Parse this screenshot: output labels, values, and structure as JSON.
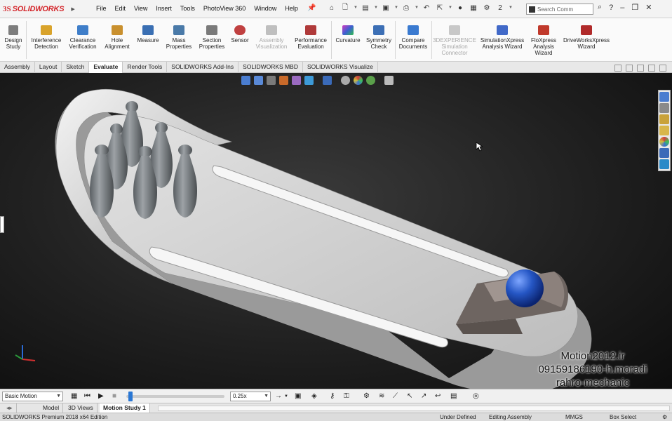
{
  "app": {
    "logo_ds": "3S",
    "logo_name": "SOLIDWORKS"
  },
  "menu": [
    "File",
    "Edit",
    "View",
    "Insert",
    "Tools",
    "PhotoView 360",
    "Window",
    "Help"
  ],
  "quick_access": {
    "icons": [
      "home-icon",
      "new-document-icon",
      "open-icon",
      "save-icon",
      "print-icon",
      "select-icon",
      "traffic-light-icon",
      "rebuild-icon",
      "options-icon"
    ],
    "selection_count": "2",
    "search_placeholder": "Search Comm"
  },
  "window_controls": [
    "help-icon",
    "minimize-icon",
    "restore-icon",
    "close-icon"
  ],
  "ribbon": {
    "design_study": "Design Study",
    "tools": [
      {
        "label": "Interference Detection",
        "enabled": true,
        "color": "#d9a32b"
      },
      {
        "label": "Clearance Verification",
        "enabled": true,
        "color": "#3f7ec9"
      },
      {
        "label": "Hole Alignment",
        "enabled": true,
        "color": "#c9902e"
      },
      {
        "label": "Measure",
        "enabled": true,
        "color": "#3a6fb3"
      },
      {
        "label": "Mass Properties",
        "enabled": true,
        "color": "#4a7aa8"
      },
      {
        "label": "Section Properties",
        "enabled": true,
        "color": "#7a7a7a"
      },
      {
        "label": "Sensor",
        "enabled": true,
        "color": "#c04040"
      },
      {
        "label": "Assembly Visualization",
        "enabled": false,
        "color": "#bfbfbf"
      },
      {
        "label": "Performance Evaluation",
        "enabled": true,
        "color": "#b03a3a"
      }
    ],
    "analysis": [
      {
        "label": "Curvature",
        "enabled": true,
        "color": "#8a3cc0"
      },
      {
        "label": "Symmetry Check",
        "enabled": true,
        "color": "#3c6fb5"
      }
    ],
    "compare": {
      "label": "Compare Documents",
      "enabled": true,
      "color": "#3a7ad0"
    },
    "simulation": [
      {
        "label": "3DEXPERIENCE Simulation Connector",
        "enabled": false,
        "color": "#c8c8c8"
      },
      {
        "label": "SimulationXpress Analysis Wizard",
        "enabled": true,
        "color": "#4169c8"
      },
      {
        "label": "FloXpress Analysis Wizard",
        "enabled": true,
        "color": "#c0392b"
      },
      {
        "label": "DriveWorksXpress Wizard",
        "enabled": true,
        "color": "#b02a2a"
      }
    ]
  },
  "tabs": [
    {
      "label": "Assembly",
      "active": false
    },
    {
      "label": "Layout",
      "active": false
    },
    {
      "label": "Sketch",
      "active": false
    },
    {
      "label": "Evaluate",
      "active": true
    },
    {
      "label": "Render Tools",
      "active": false
    },
    {
      "label": "SOLIDWORKS Add-Ins",
      "active": false
    },
    {
      "label": "SOLIDWORKS MBD",
      "active": false
    },
    {
      "label": "SOLIDWORKS Visualize",
      "active": false
    }
  ],
  "heads_up_toolbar": [
    "zoom-to-fit-icon",
    "zoom-area-icon",
    "previous-view-icon",
    "section-view-icon",
    "dynamic-annotation-icon",
    "view-orientation-icon",
    "display-style-icon",
    "hide-show-icon",
    "edit-appearance-icon",
    "apply-scene-icon",
    "view-settings-icon"
  ],
  "task_pane": [
    "home-icon",
    "resources-icon",
    "design-library-icon",
    "file-explorer-icon",
    "appearances-icon",
    "custom-properties-icon",
    "solidworks-forum-icon"
  ],
  "watermark": [
    "Motion2012.ir",
    "09159186190-h.moradi",
    "rahro-mechanic"
  ],
  "motion": {
    "study_type": "Basic Motion",
    "playback_speed": "0.25x",
    "controls": [
      "calculate-icon",
      "play-from-start-icon",
      "play-icon",
      "stop-icon"
    ],
    "timeline_position": 0.02
  },
  "bottom_tabs": [
    {
      "label": "Model",
      "active": false
    },
    {
      "label": "3D Views",
      "active": false
    },
    {
      "label": "Motion Study 1",
      "active": true
    }
  ],
  "status": {
    "edition": "SOLIDWORKS Premium 2018 x64 Edition",
    "definition": "Under Defined",
    "mode": "Editing Assembly",
    "units": "MMGS",
    "select_mode": "Box Select"
  },
  "colors": {
    "brand": "#d4262b",
    "ball": "#2556c4",
    "pins": "#8a8f93",
    "lane": "#d6d6d6",
    "launcher": "#6e6561"
  }
}
